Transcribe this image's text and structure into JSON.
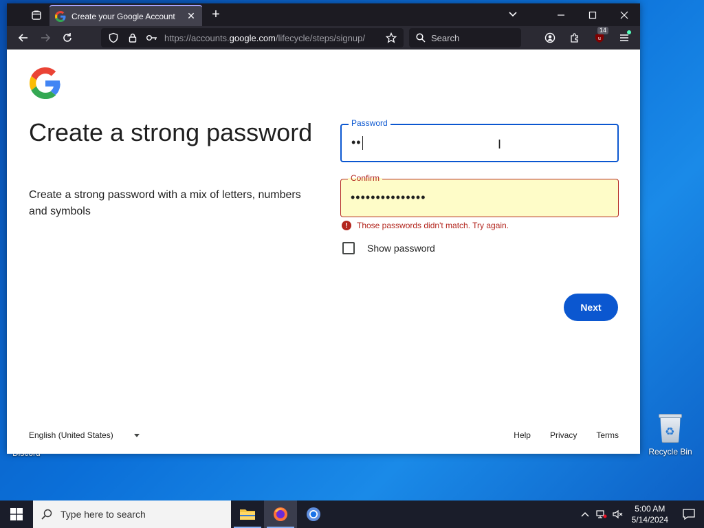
{
  "desktop": {
    "icons": [
      {
        "label": "Discord"
      },
      {
        "label": "Recycle Bin"
      }
    ]
  },
  "browser": {
    "tab": {
      "title": "Create your Google Account",
      "favicon": "google-g-icon"
    },
    "url": {
      "prefix": "https://accounts.",
      "domain": "google.com",
      "path": "/lifecycle/steps/signup/"
    },
    "search_placeholder": "Search",
    "extension_badge": "14"
  },
  "page": {
    "headline": "Create a strong password",
    "subtext": "Create a strong password with a mix of letters, numbers and symbols",
    "password": {
      "label": "Password",
      "value": "••"
    },
    "confirm": {
      "label": "Confirm",
      "value": "•••••••••••••••"
    },
    "error": "Those passwords didn't match. Try again.",
    "show_password_label": "Show password",
    "next_label": "Next",
    "footer": {
      "language": "English (United States)",
      "links": [
        "Help",
        "Privacy",
        "Terms"
      ]
    }
  },
  "taskbar": {
    "search_placeholder": "Type here to search",
    "time": "5:00 AM",
    "date": "5/14/2024"
  },
  "colors": {
    "accent_blue": "#0b57d0",
    "error_red": "#b3261e",
    "confirm_bg": "#fefcc8"
  }
}
